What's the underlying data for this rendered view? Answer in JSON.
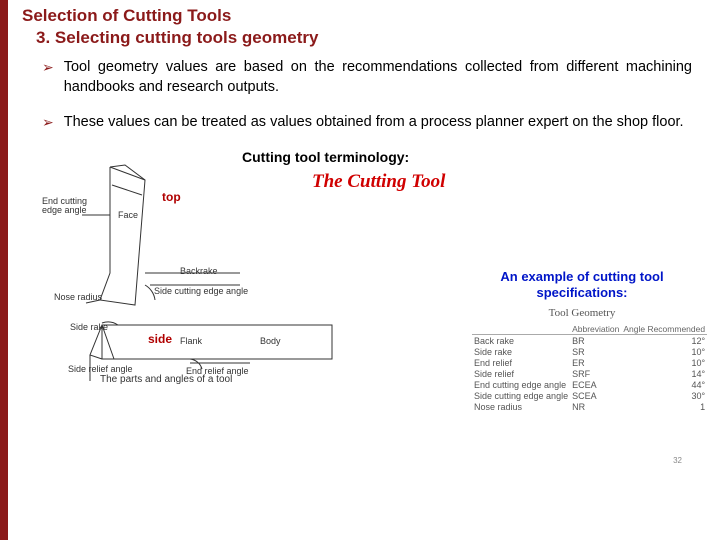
{
  "title": "Selection of Cutting Tools",
  "subtitle": "3. Selecting cutting tools geometry",
  "bullets": [
    "Tool geometry values are based on the recommendations collected from different machining handbooks and research outputs.",
    "These values can be treated as values obtained from a process planner expert on the shop floor."
  ],
  "figure": {
    "terminology_pre": "Cutting tool ",
    "terminology_post": "terminology:",
    "cutting_tool_title": "The Cutting Tool",
    "labels": {
      "top": "top",
      "side": "side",
      "end_cutting_edge_angle": "End cutting\nedge angle",
      "face": "Face",
      "nose_radius": "Nose\nradius",
      "side_cutting_edge_angle": "Side cutting edge angle",
      "backrake": "Backrake",
      "side_rake": "Side\nrake",
      "flank": "Flank",
      "body": "Body",
      "side_relief_angle": "Side\nrelief\nangle",
      "end_relief_angle": "End relief angle"
    },
    "caption": "The parts and angles of a tool"
  },
  "spec": {
    "title": "An example of cutting tool specifications:",
    "header": "Tool Geometry",
    "columns": [
      "",
      "Abbreviation",
      "Angle\nRecommended"
    ],
    "rows": [
      [
        "Back rake",
        "BR",
        "12°"
      ],
      [
        "Side rake",
        "SR",
        "10°"
      ],
      [
        "End relief",
        "ER",
        "10°"
      ],
      [
        "Side relief",
        "SRF",
        "14°"
      ],
      [
        "End cutting edge angle",
        "ECEA",
        "44°"
      ],
      [
        "Side cutting edge angle",
        "SCEA",
        "30°"
      ],
      [
        "Nose radius",
        "NR",
        "1"
      ]
    ]
  },
  "page_number": "32"
}
